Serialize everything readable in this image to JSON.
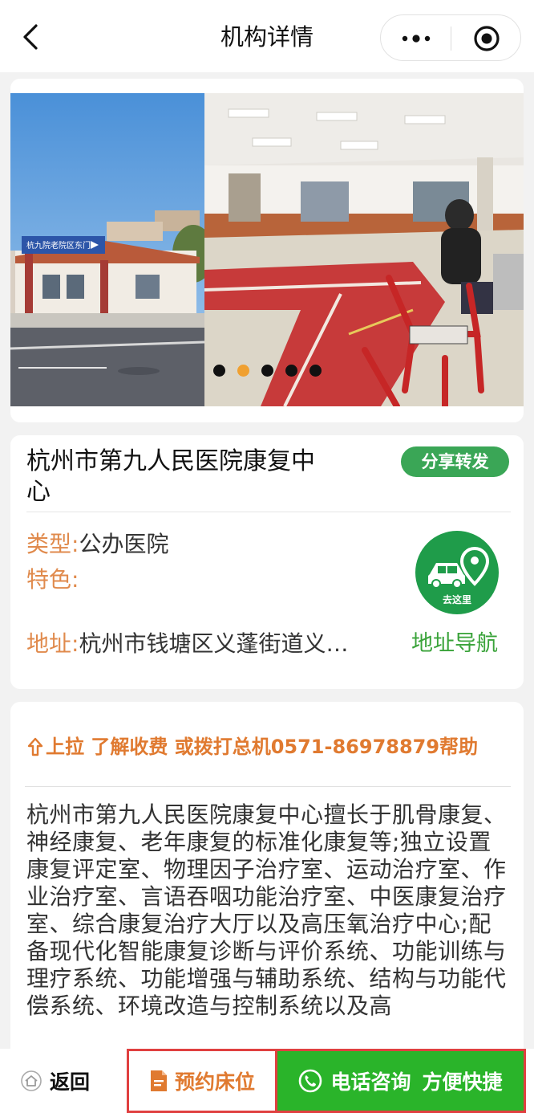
{
  "navbar": {
    "title": "机构详情",
    "back_icon": "chevron-left-icon",
    "more_icon": "more-dots-icon",
    "close_icon": "target-circle-icon"
  },
  "carousel": {
    "slide_left_sign": "杭九院老院区东门",
    "slides_count": 5,
    "active_index": 1
  },
  "institution": {
    "name": "杭州市第九人民医院康复中心",
    "share_label": "分享转发",
    "type_label": "类型:",
    "type_value": "公办医院",
    "feature_label": "特色:",
    "feature_value": "",
    "address_label": "地址:",
    "address_value": "杭州市钱塘区义蓬街道义…",
    "nav_icon_text": "去这里",
    "nav_link_label": "地址导航"
  },
  "description": {
    "hint": "上拉 了解收费 或拨打总机0571-86978879帮助",
    "text": "杭州市第九人民医院康复中心擅长于肌骨康复、神经康复、老年康复的标准化康复等;独立设置康复评定室、物理因子治疗室、运动治疗室、作业治疗室、言语吞咽功能治疗室、中医康复治疗室、综合康复治疗大厅以及高压氧治疗中心;配备现代化智能康复诊断与评价系统、功能训练与理疗系统、功能增强与辅助系统、结构与功能代偿系统、环境改造与控制系统以及高"
  },
  "bottombar": {
    "home_label": "返回",
    "book_label": "预约床位",
    "call_label": "电话咨询",
    "call_sub": "方便快捷"
  },
  "colors": {
    "accent_orange": "#e07a30",
    "label_orange": "#e08a4c",
    "green": "#3aa656",
    "call_green": "#2ab42a",
    "highlight_red": "#e04040"
  }
}
